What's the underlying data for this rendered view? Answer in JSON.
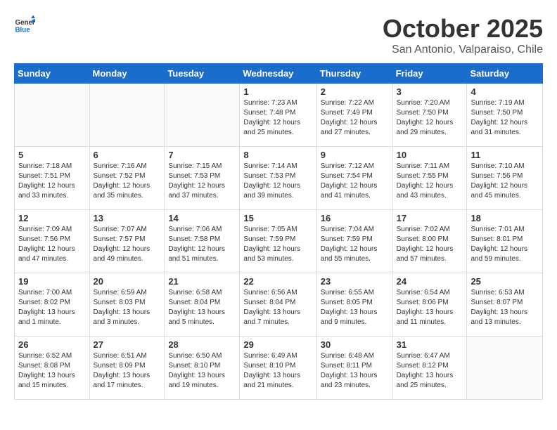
{
  "logo": {
    "general": "General",
    "blue": "Blue"
  },
  "header": {
    "month": "October 2025",
    "location": "San Antonio, Valparaiso, Chile"
  },
  "days_of_week": [
    "Sunday",
    "Monday",
    "Tuesday",
    "Wednesday",
    "Thursday",
    "Friday",
    "Saturday"
  ],
  "weeks": [
    [
      {
        "day": "",
        "sunrise": "",
        "sunset": "",
        "daylight": ""
      },
      {
        "day": "",
        "sunrise": "",
        "sunset": "",
        "daylight": ""
      },
      {
        "day": "",
        "sunrise": "",
        "sunset": "",
        "daylight": ""
      },
      {
        "day": "1",
        "sunrise": "Sunrise: 7:23 AM",
        "sunset": "Sunset: 7:48 PM",
        "daylight": "Daylight: 12 hours and 25 minutes."
      },
      {
        "day": "2",
        "sunrise": "Sunrise: 7:22 AM",
        "sunset": "Sunset: 7:49 PM",
        "daylight": "Daylight: 12 hours and 27 minutes."
      },
      {
        "day": "3",
        "sunrise": "Sunrise: 7:20 AM",
        "sunset": "Sunset: 7:50 PM",
        "daylight": "Daylight: 12 hours and 29 minutes."
      },
      {
        "day": "4",
        "sunrise": "Sunrise: 7:19 AM",
        "sunset": "Sunset: 7:50 PM",
        "daylight": "Daylight: 12 hours and 31 minutes."
      }
    ],
    [
      {
        "day": "5",
        "sunrise": "Sunrise: 7:18 AM",
        "sunset": "Sunset: 7:51 PM",
        "daylight": "Daylight: 12 hours and 33 minutes."
      },
      {
        "day": "6",
        "sunrise": "Sunrise: 7:16 AM",
        "sunset": "Sunset: 7:52 PM",
        "daylight": "Daylight: 12 hours and 35 minutes."
      },
      {
        "day": "7",
        "sunrise": "Sunrise: 7:15 AM",
        "sunset": "Sunset: 7:53 PM",
        "daylight": "Daylight: 12 hours and 37 minutes."
      },
      {
        "day": "8",
        "sunrise": "Sunrise: 7:14 AM",
        "sunset": "Sunset: 7:53 PM",
        "daylight": "Daylight: 12 hours and 39 minutes."
      },
      {
        "day": "9",
        "sunrise": "Sunrise: 7:12 AM",
        "sunset": "Sunset: 7:54 PM",
        "daylight": "Daylight: 12 hours and 41 minutes."
      },
      {
        "day": "10",
        "sunrise": "Sunrise: 7:11 AM",
        "sunset": "Sunset: 7:55 PM",
        "daylight": "Daylight: 12 hours and 43 minutes."
      },
      {
        "day": "11",
        "sunrise": "Sunrise: 7:10 AM",
        "sunset": "Sunset: 7:56 PM",
        "daylight": "Daylight: 12 hours and 45 minutes."
      }
    ],
    [
      {
        "day": "12",
        "sunrise": "Sunrise: 7:09 AM",
        "sunset": "Sunset: 7:56 PM",
        "daylight": "Daylight: 12 hours and 47 minutes."
      },
      {
        "day": "13",
        "sunrise": "Sunrise: 7:07 AM",
        "sunset": "Sunset: 7:57 PM",
        "daylight": "Daylight: 12 hours and 49 minutes."
      },
      {
        "day": "14",
        "sunrise": "Sunrise: 7:06 AM",
        "sunset": "Sunset: 7:58 PM",
        "daylight": "Daylight: 12 hours and 51 minutes."
      },
      {
        "day": "15",
        "sunrise": "Sunrise: 7:05 AM",
        "sunset": "Sunset: 7:59 PM",
        "daylight": "Daylight: 12 hours and 53 minutes."
      },
      {
        "day": "16",
        "sunrise": "Sunrise: 7:04 AM",
        "sunset": "Sunset: 7:59 PM",
        "daylight": "Daylight: 12 hours and 55 minutes."
      },
      {
        "day": "17",
        "sunrise": "Sunrise: 7:02 AM",
        "sunset": "Sunset: 8:00 PM",
        "daylight": "Daylight: 12 hours and 57 minutes."
      },
      {
        "day": "18",
        "sunrise": "Sunrise: 7:01 AM",
        "sunset": "Sunset: 8:01 PM",
        "daylight": "Daylight: 12 hours and 59 minutes."
      }
    ],
    [
      {
        "day": "19",
        "sunrise": "Sunrise: 7:00 AM",
        "sunset": "Sunset: 8:02 PM",
        "daylight": "Daylight: 13 hours and 1 minute."
      },
      {
        "day": "20",
        "sunrise": "Sunrise: 6:59 AM",
        "sunset": "Sunset: 8:03 PM",
        "daylight": "Daylight: 13 hours and 3 minutes."
      },
      {
        "day": "21",
        "sunrise": "Sunrise: 6:58 AM",
        "sunset": "Sunset: 8:04 PM",
        "daylight": "Daylight: 13 hours and 5 minutes."
      },
      {
        "day": "22",
        "sunrise": "Sunrise: 6:56 AM",
        "sunset": "Sunset: 8:04 PM",
        "daylight": "Daylight: 13 hours and 7 minutes."
      },
      {
        "day": "23",
        "sunrise": "Sunrise: 6:55 AM",
        "sunset": "Sunset: 8:05 PM",
        "daylight": "Daylight: 13 hours and 9 minutes."
      },
      {
        "day": "24",
        "sunrise": "Sunrise: 6:54 AM",
        "sunset": "Sunset: 8:06 PM",
        "daylight": "Daylight: 13 hours and 11 minutes."
      },
      {
        "day": "25",
        "sunrise": "Sunrise: 6:53 AM",
        "sunset": "Sunset: 8:07 PM",
        "daylight": "Daylight: 13 hours and 13 minutes."
      }
    ],
    [
      {
        "day": "26",
        "sunrise": "Sunrise: 6:52 AM",
        "sunset": "Sunset: 8:08 PM",
        "daylight": "Daylight: 13 hours and 15 minutes."
      },
      {
        "day": "27",
        "sunrise": "Sunrise: 6:51 AM",
        "sunset": "Sunset: 8:09 PM",
        "daylight": "Daylight: 13 hours and 17 minutes."
      },
      {
        "day": "28",
        "sunrise": "Sunrise: 6:50 AM",
        "sunset": "Sunset: 8:10 PM",
        "daylight": "Daylight: 13 hours and 19 minutes."
      },
      {
        "day": "29",
        "sunrise": "Sunrise: 6:49 AM",
        "sunset": "Sunset: 8:10 PM",
        "daylight": "Daylight: 13 hours and 21 minutes."
      },
      {
        "day": "30",
        "sunrise": "Sunrise: 6:48 AM",
        "sunset": "Sunset: 8:11 PM",
        "daylight": "Daylight: 13 hours and 23 minutes."
      },
      {
        "day": "31",
        "sunrise": "Sunrise: 6:47 AM",
        "sunset": "Sunset: 8:12 PM",
        "daylight": "Daylight: 13 hours and 25 minutes."
      },
      {
        "day": "",
        "sunrise": "",
        "sunset": "",
        "daylight": ""
      }
    ]
  ]
}
